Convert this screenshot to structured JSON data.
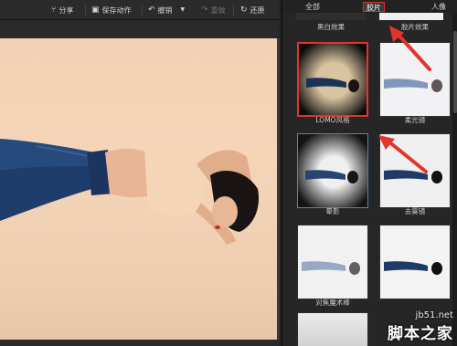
{
  "toolbar": {
    "share_label": "分享",
    "save_action_label": "保存动作",
    "undo_label": "撤销",
    "redo_label": "重做",
    "restore_label": "还原"
  },
  "panel": {
    "tabs": [
      {
        "label": "全部",
        "active": false
      },
      {
        "label": "胶片",
        "active": true
      },
      {
        "label": "人像",
        "active": false
      }
    ],
    "effects_top_row": [
      "黑白效果",
      "胶片效果"
    ],
    "effects": [
      {
        "label": "LOMO风格",
        "highlight": "red"
      },
      {
        "label": "柔光镜",
        "highlight": "none"
      },
      {
        "label": "晕影",
        "highlight": "blue"
      },
      {
        "label": "去雾镜",
        "highlight": "none"
      },
      {
        "label": "对焦魔术棒",
        "highlight": "none"
      },
      {
        "label": "",
        "highlight": "none"
      }
    ]
  },
  "annotation_color": "#e3352b",
  "watermark": {
    "url": "jb51.net",
    "name": "脚本之家"
  }
}
